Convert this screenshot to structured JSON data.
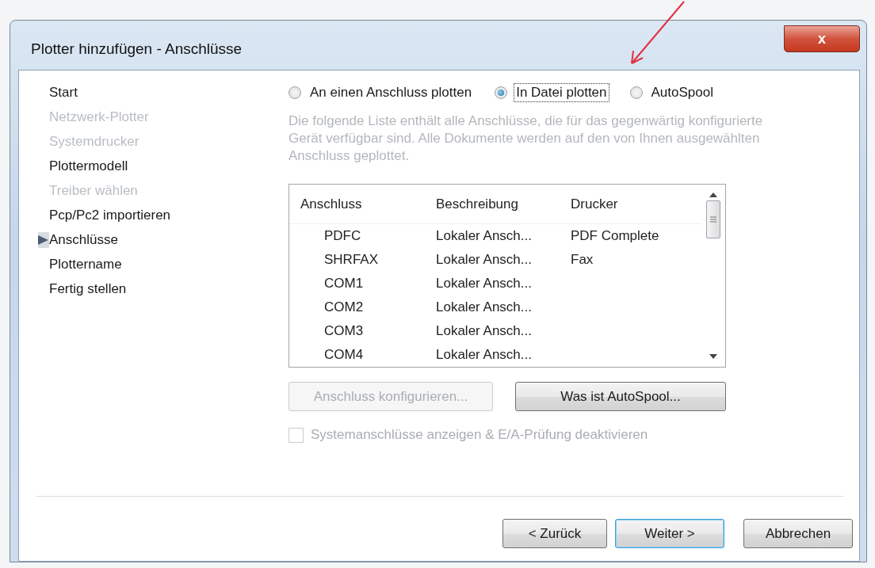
{
  "window": {
    "title": "Plotter hinzufügen - Anschlüsse",
    "close_label": "x"
  },
  "steps": [
    {
      "label": "Start",
      "disabled": false,
      "selected": false
    },
    {
      "label": "Netzwerk-Plotter",
      "disabled": true,
      "selected": false
    },
    {
      "label": "Systemdrucker",
      "disabled": true,
      "selected": false
    },
    {
      "label": "Plottermodell",
      "disabled": false,
      "selected": false
    },
    {
      "label": "Treiber wählen",
      "disabled": true,
      "selected": false
    },
    {
      "label": "Pcp/Pc2 importieren",
      "disabled": false,
      "selected": false
    },
    {
      "label": "Anschlüsse",
      "disabled": false,
      "selected": true
    },
    {
      "label": "Plottername",
      "disabled": false,
      "selected": false
    },
    {
      "label": "Fertig stellen",
      "disabled": false,
      "selected": false
    }
  ],
  "radios": [
    {
      "label": "An einen Anschluss plotten",
      "selected": false,
      "focused": false
    },
    {
      "label": "In Datei plotten",
      "selected": true,
      "focused": true
    },
    {
      "label": "AutoSpool",
      "selected": false,
      "focused": false
    }
  ],
  "description": "Die folgende Liste enthält alle Anschlüsse, die für das gegenwärtig konfigurierte Gerät verfügbar sind. Alle Dokumente werden auf den von Ihnen ausgewählten Anschluss geplottet.",
  "description_disabled": true,
  "table": {
    "columns": [
      "Anschluss",
      "Beschreibung",
      "Drucker"
    ],
    "rows": [
      {
        "port": "PDFC",
        "description": "Lokaler Ansch...",
        "printer": "PDF Complete"
      },
      {
        "port": "SHRFAX",
        "description": "Lokaler Ansch...",
        "printer": "Fax"
      },
      {
        "port": "COM1",
        "description": "Lokaler Ansch..."
      },
      {
        "port": "COM2",
        "description": "Lokaler Ansch..."
      },
      {
        "port": "COM3",
        "description": "Lokaler Ansch..."
      },
      {
        "port": "COM4",
        "description": "Lokaler Ansch..."
      }
    ]
  },
  "action_buttons": [
    {
      "label": "Anschluss konfigurieren...",
      "disabled": true
    },
    {
      "label": "Was ist AutoSpool...",
      "disabled": false
    }
  ],
  "checkbox": {
    "label": "Systemanschlüsse anzeigen & E/A-Prüfung deaktivieren",
    "checked": false,
    "disabled": true
  },
  "footer_buttons": [
    {
      "label": "< Zurück",
      "default": false
    },
    {
      "label": "Weiter >",
      "default": true
    },
    {
      "label": "Abbrechen",
      "default": false
    }
  ]
}
